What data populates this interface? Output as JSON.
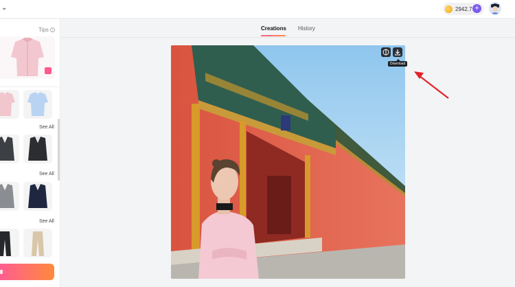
{
  "header": {
    "credits": "2942.7",
    "plus_icon": "plus-icon",
    "chevron_icon": "chevron-down-icon",
    "avatar_icon": "user-avatar"
  },
  "sidebar": {
    "tips_label": "Tips",
    "see_all_label": "See All",
    "generate_icon": "generate-button"
  },
  "tabs": [
    {
      "label": "Creations",
      "active": true
    },
    {
      "label": "History",
      "active": false
    }
  ],
  "image_actions": {
    "compare_icon": "compare-icon",
    "download_icon": "download-icon",
    "download_tooltip": "Download"
  },
  "colors": {
    "accent": "#ff5d8f",
    "accent_end": "#ff8a3d",
    "purple": "#7b5cf0",
    "wall": "#e8634f"
  }
}
